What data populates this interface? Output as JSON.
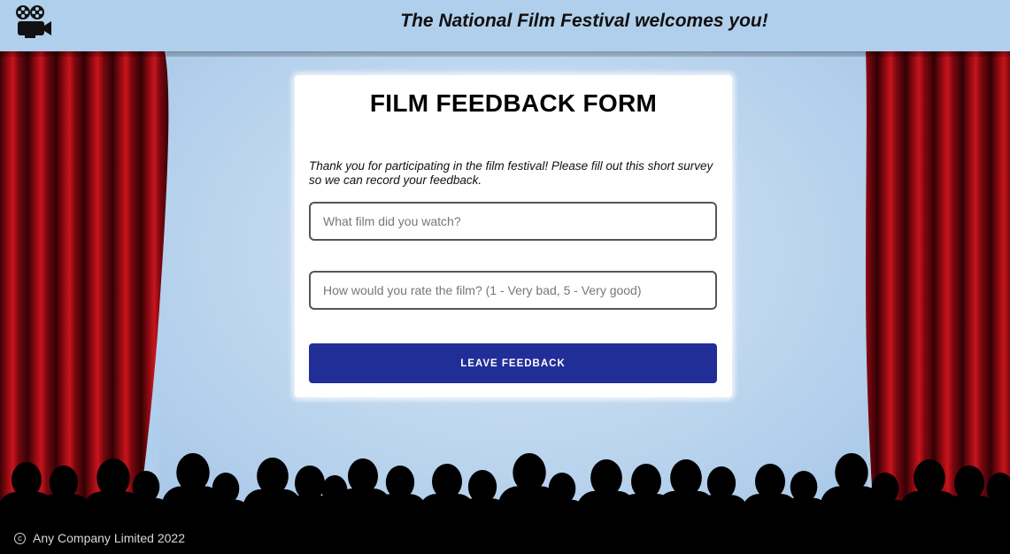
{
  "header": {
    "title": "The National Film Festival welcomes you!",
    "logo_icon": "movie-camera-icon"
  },
  "form": {
    "title": "FILM FEEDBACK FORM",
    "intro": "Thank you for participating in the film festival! Please fill out this short survey so we can record your feedback.",
    "film_field": {
      "value": "",
      "placeholder": "What film did you watch?"
    },
    "rating_field": {
      "value": "",
      "placeholder": "How would you rate the film? (1 - Very bad, 5 - Very good)"
    },
    "submit_label": "LEAVE FEEDBACK"
  },
  "footer": {
    "copyright_symbol": "c",
    "text": "Any Company Limited 2022"
  },
  "colors": {
    "background": "#b0cfec",
    "button": "#222e98",
    "curtain": "#9b0b14",
    "audience": "#000000"
  }
}
